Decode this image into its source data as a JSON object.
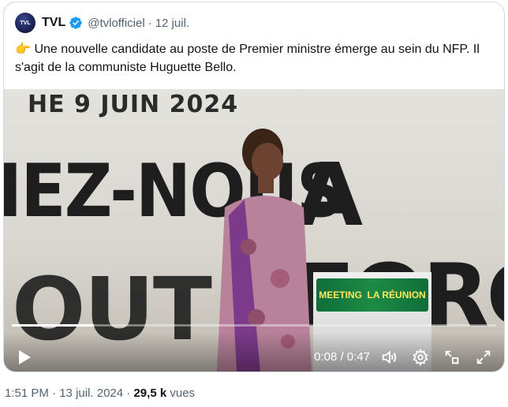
{
  "tweet": {
    "author_name": "TVL",
    "handle": "@tvlofficiel",
    "separator": "·",
    "date": "12 juil.",
    "avatar_text": "TVL",
    "emoji": "👉",
    "text": "Une nouvelle candidate au poste de Premier ministre émerge au sein du NFP. Il s'agit de la communiste Huguette Bello."
  },
  "video": {
    "banner_top": "HE 9 JUIN 2024",
    "banner_line1": "IEZ-NOUS",
    "banner_line2": "A FORC",
    "banner_line3": "OUT",
    "lectern_left": "MEETING",
    "lectern_right": "LA RÉUNION",
    "current_time": "0:08",
    "duration": "0:47",
    "time_display": "0:08 / 0:47",
    "progress": 0.17
  },
  "footer": {
    "time": "1:51 PM",
    "sep1": "·",
    "date": "13 juil. 2024",
    "sep2": "·",
    "views_count": "29,5 k",
    "views_label": "vues"
  },
  "icons": {
    "verified": "verified-badge-icon",
    "play": "play-icon",
    "volume": "volume-icon",
    "settings": "gear-icon",
    "pip": "pip-icon",
    "fullscreen": "fullscreen-icon"
  },
  "colors": {
    "verified_blue": "#1d9bf0",
    "secondary_text": "#536471",
    "border": "#cfd9de"
  }
}
